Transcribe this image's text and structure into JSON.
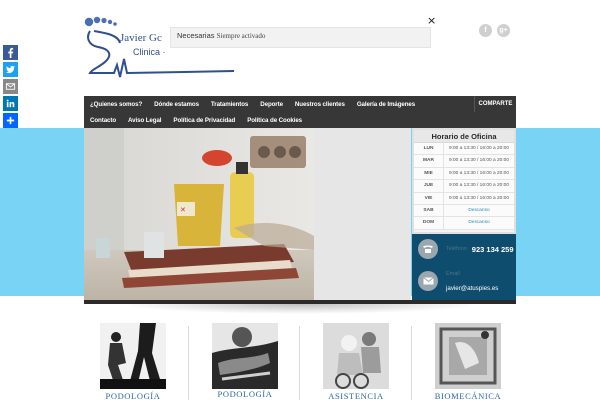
{
  "share_sidebar": {
    "items": [
      {
        "name": "facebook",
        "color": "#3b5998",
        "glyph": "f"
      },
      {
        "name": "twitter",
        "color": "#1da1f2",
        "glyph": "t"
      },
      {
        "name": "email",
        "color": "#888888",
        "glyph": "✉"
      },
      {
        "name": "linkedin",
        "color": "#0077b5",
        "glyph": "in"
      },
      {
        "name": "share",
        "color": "#0166ff",
        "glyph": "+"
      }
    ]
  },
  "logo": {
    "line1": "Javier Gc",
    "line2": "Clinica ·",
    "color": "#2f4f8f"
  },
  "cookie_bar": {
    "category": "Necesarias",
    "status": "Siempre activado",
    "close_glyph": "×"
  },
  "social_top": [
    {
      "name": "facebook",
      "glyph": "f"
    },
    {
      "name": "google-plus",
      "glyph": "g+"
    }
  ],
  "nav": {
    "row1": [
      "¿Quienes somos?",
      "Dónde estamos",
      "Tratamientos",
      "Deporte",
      "Nuestros clientes",
      "Galería de Imágenes"
    ],
    "row2": [
      "Contacto",
      "Aviso Legal",
      "Política de Privacidad",
      "Política de Cookies"
    ],
    "share_label": "COMPARTE"
  },
  "hours": {
    "title": "Horario de Oficina",
    "rows": [
      {
        "day": "LUN",
        "time": "9:00 a 13:30 / 16:00 a 20:00"
      },
      {
        "day": "MAR",
        "time": "9:00 a 13:30 / 16:00 a 20:00"
      },
      {
        "day": "MIE",
        "time": "9:00 a 13:30 / 16:00 a 20:00"
      },
      {
        "day": "JUE",
        "time": "9:00 a 13:30 / 16:00 a 20:00"
      },
      {
        "day": "VIE",
        "time": "9:00 a 13:30 / 16:00 a 20:00"
      },
      {
        "day": "SAB",
        "time": "Descanso"
      },
      {
        "day": "DOM",
        "time": "Descanso"
      }
    ]
  },
  "contact": {
    "phone_label": "Teléfono",
    "phone": "923 134 259",
    "email_label": "Email",
    "email": "javier@atuspies.es"
  },
  "services": [
    {
      "label": "PODOLOGÍA"
    },
    {
      "label": "PODOLOGÍA"
    },
    {
      "label": "ASISTENCIA"
    },
    {
      "label": "BIOMECÁNICA"
    }
  ]
}
